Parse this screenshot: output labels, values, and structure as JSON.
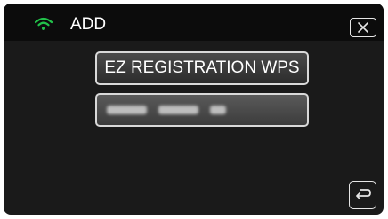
{
  "header": {
    "title": "ADD",
    "wifi_icon": "wifi-icon",
    "close_icon": "close-icon",
    "accent_color": "#22c14a"
  },
  "menu": {
    "wps_label": "EZ REGISTRATION WPS",
    "device_entry": "blurred device name (obscured)"
  },
  "footer": {
    "back_icon": "return-arrow-icon"
  }
}
